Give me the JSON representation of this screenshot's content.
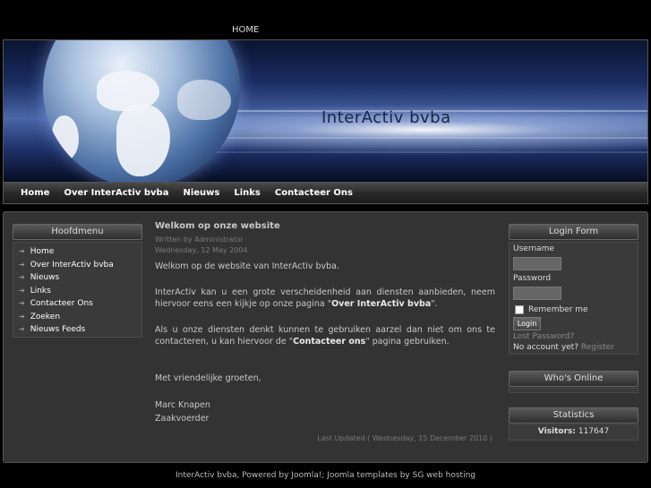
{
  "topnav": {
    "home": "HOME"
  },
  "site": {
    "title": "InterActiv bvba"
  },
  "mainmenu": [
    "Home",
    "Over InterActiv bvba",
    "Nieuws",
    "Links",
    "Contacteer Ons"
  ],
  "leftmenu": {
    "title": "Hoofdmenu",
    "items": [
      "Home",
      "Over InterActiv bvba",
      "Nieuws",
      "Links",
      "Contacteer Ons",
      "Zoeken",
      "Nieuws Feeds"
    ]
  },
  "article": {
    "title": "Welkom op onze website",
    "author": "Written by Administrator",
    "date": "Wednesday, 12 May 2004",
    "p1": "Welkom op de website van InterActiv bvba.",
    "p2_pre": "InterActiv kan u een grote verscheidenheid aan diensten aanbieden, neem hiervoor eens een kijkje op onze pagina \"",
    "p2_bold": "Over InterActiv bvba",
    "p2_post": "\".",
    "p3_pre": "Als u onze diensten denkt kunnen te gebruiken aarzel dan niet om ons te contacteren, u kan hiervoor de \"",
    "p3_bold": "Contacteer ons",
    "p3_post": "\" pagina gebruiken.",
    "greeting": "Met vriendelijke groeten,",
    "name": "Marc Knapen",
    "role": "Zaakvoerder",
    "updated": "Last Updated ( Wednesday, 15 December 2010 )"
  },
  "login": {
    "title": "Login Form",
    "username_label": "Username",
    "password_label": "Password",
    "remember": "Remember me",
    "button": "Login",
    "lost_password": "Lost Password?",
    "no_account": "No account yet?",
    "register": "Register"
  },
  "whos_online": {
    "title": "Who's Online"
  },
  "statistics": {
    "title": "Statistics",
    "visitors_label": "Visitors:",
    "visitors_value": "117647"
  },
  "footer": {
    "text": "InterActiv bvba, Powered by Joomla!; Joomla templates by SG web hosting"
  }
}
